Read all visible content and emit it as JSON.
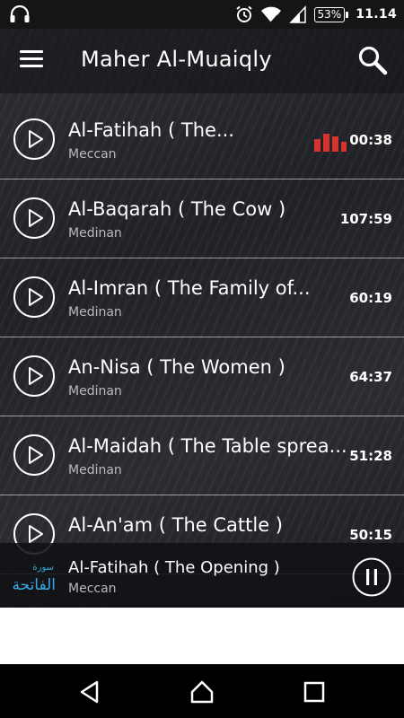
{
  "status_bar": {
    "battery": "53%",
    "time": "11.14",
    "icons": [
      "headphones-icon",
      "alarm-icon",
      "wifi-icon",
      "signal-icon",
      "battery-icon"
    ]
  },
  "toolbar": {
    "title": "Maher Al-Muaiqly",
    "menu_icon": "hamburger-menu-icon",
    "search_icon": "search-icon"
  },
  "surahs": [
    {
      "title": "Al-Fatihah ( The...",
      "type": "Meccan",
      "duration": "00:38",
      "playing": true
    },
    {
      "title": "Al-Baqarah ( The Cow )",
      "type": "Medinan",
      "duration": "107:59",
      "playing": false
    },
    {
      "title": "Al-Imran ( The Family of...",
      "type": "Medinan",
      "duration": "60:19",
      "playing": false
    },
    {
      "title": "An-Nisa ( The Women )",
      "type": "Medinan",
      "duration": "64:37",
      "playing": false
    },
    {
      "title": "Al-Maidah ( The Table sprea...",
      "type": "Medinan",
      "duration": "51:28",
      "playing": false
    },
    {
      "title": "Al-An'am ( The Cattle )",
      "type": "",
      "duration": "50:15",
      "playing": false
    }
  ],
  "now_playing": {
    "title": "Al-Fatihah ( The Opening )",
    "type": "Meccan",
    "logo_text": "سورة الفاتحة",
    "control": "pause-icon"
  },
  "colors": {
    "equalizer": "#d8332c",
    "logo": "#39a9e0"
  },
  "nav_bar": [
    "back-icon",
    "home-icon",
    "recents-icon"
  ]
}
